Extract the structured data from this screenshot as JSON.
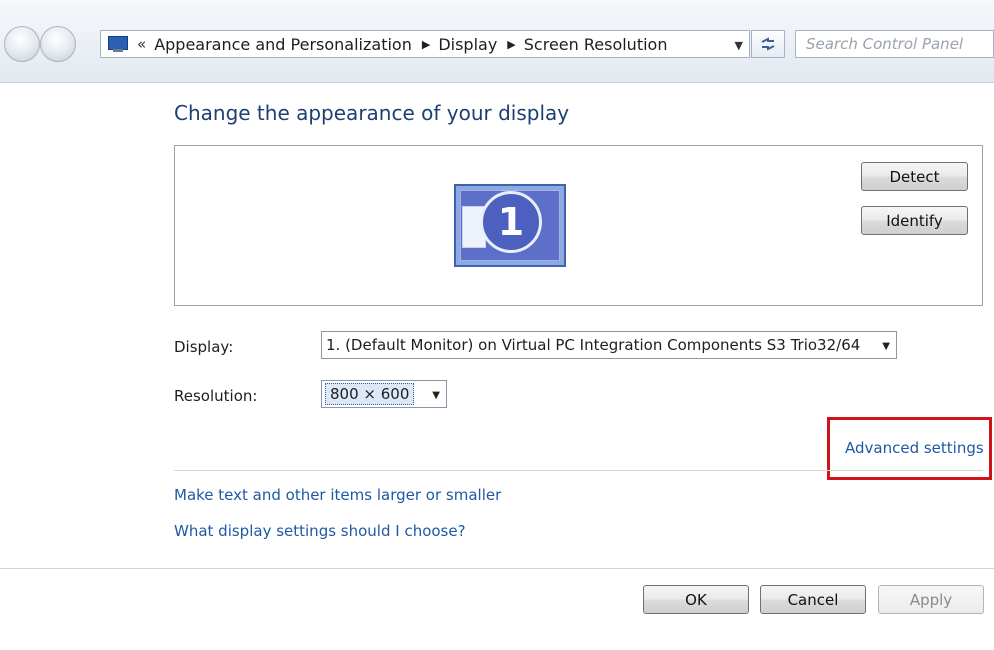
{
  "address_bar": {
    "overflow_chevron": "«",
    "crumbs": [
      "Appearance and Personalization",
      "Display",
      "Screen Resolution"
    ],
    "separator": "▶",
    "dropdown_arrow": "▼"
  },
  "search": {
    "placeholder": "Search Control Panel"
  },
  "main": {
    "title": "Change the appearance of your display",
    "monitor_number": "1",
    "detect_label": "Detect",
    "identify_label": "Identify",
    "display_label": "Display:",
    "display_value": "1. (Default Monitor) on Virtual PC Integration Components S3 Trio32/64",
    "resolution_label": "Resolution:",
    "resolution_value": "800 × 600",
    "advanced_settings": "Advanced settings",
    "help_links": [
      "Make text and other items larger or smaller",
      "What display settings should I choose?"
    ]
  },
  "footer": {
    "ok": "OK",
    "cancel": "Cancel",
    "apply": "Apply"
  },
  "colors": {
    "link": "#1f59a5",
    "title": "#1e3f73",
    "highlight": "#d0121b"
  },
  "icons": [
    "back-icon",
    "forward-icon",
    "monitor-icon",
    "refresh-icon",
    "dropdown-arrow-icon"
  ]
}
